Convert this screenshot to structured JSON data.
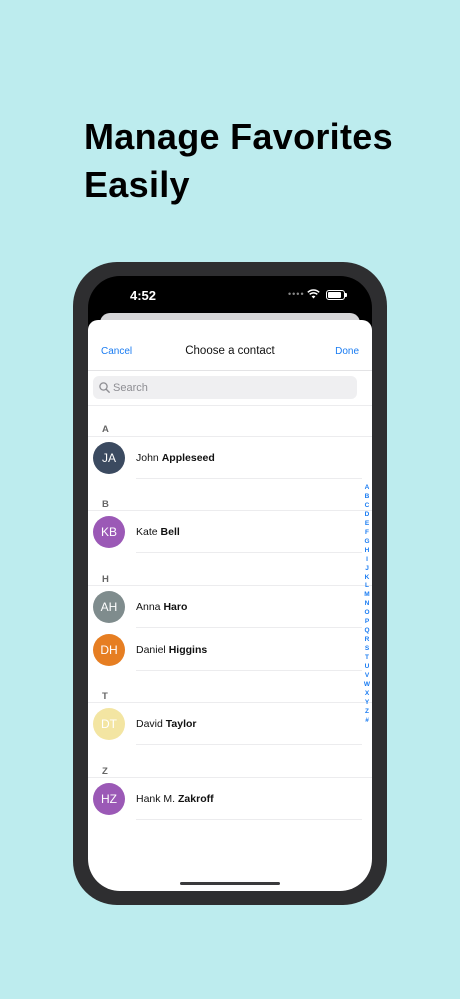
{
  "headline": {
    "line1": "Manage Favorites",
    "line2": "Easily"
  },
  "status": {
    "time": "4:52",
    "dots": "••••"
  },
  "nav": {
    "cancel": "Cancel",
    "title": "Choose a contact",
    "done": "Done"
  },
  "search": {
    "placeholder": "Search"
  },
  "sections": [
    {
      "letter": "A",
      "contacts": [
        {
          "initials": "JA",
          "first": "John",
          "last": "Appleseed",
          "color": "#3b4a60"
        }
      ]
    },
    {
      "letter": "B",
      "contacts": [
        {
          "initials": "KB",
          "first": "Kate",
          "last": "Bell",
          "color": "#9b59b6"
        }
      ]
    },
    {
      "letter": "H",
      "contacts": [
        {
          "initials": "AH",
          "first": "Anna",
          "last": "Haro",
          "color": "#7f8c8d"
        },
        {
          "initials": "DH",
          "first": "Daniel",
          "last": "Higgins",
          "color": "#e67e22"
        }
      ]
    },
    {
      "letter": "T",
      "contacts": [
        {
          "initials": "DT",
          "first": "David",
          "last": "Taylor",
          "color": "#f3e5a2"
        }
      ]
    },
    {
      "letter": "Z",
      "contacts": [
        {
          "initials": "HZ",
          "first": "Hank M.",
          "last": "Zakroff",
          "color": "#9b59b6"
        }
      ]
    }
  ],
  "index_letters": [
    "A",
    "B",
    "C",
    "D",
    "E",
    "F",
    "G",
    "H",
    "I",
    "J",
    "K",
    "L",
    "M",
    "N",
    "O",
    "P",
    "Q",
    "R",
    "S",
    "T",
    "U",
    "V",
    "W",
    "X",
    "Y",
    "Z",
    "#"
  ],
  "colors": {
    "background": "#bdecee",
    "accent": "#1a7cf2",
    "phone_frame": "#2e2e30"
  }
}
